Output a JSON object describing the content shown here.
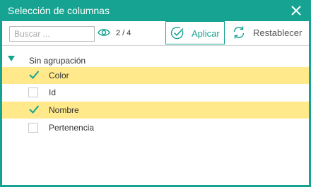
{
  "dialog": {
    "title": "Selección de columnas",
    "accent_color": "#17a391",
    "highlight_color": "#ffe98a"
  },
  "toolbar": {
    "search_placeholder": "Buscar ...",
    "search_value": "",
    "counter": "2 / 4",
    "apply_label": "Aplicar",
    "reset_label": "Restablecer",
    "icons": [
      "eye-icon",
      "check-circle-icon",
      "refresh-icon"
    ]
  },
  "group": {
    "label": "Sin agrupación",
    "expanded": true
  },
  "columns": [
    {
      "label": "Color",
      "checked": true
    },
    {
      "label": "Id",
      "checked": false
    },
    {
      "label": "Nombre",
      "checked": true
    },
    {
      "label": "Pertenencia",
      "checked": false
    }
  ]
}
